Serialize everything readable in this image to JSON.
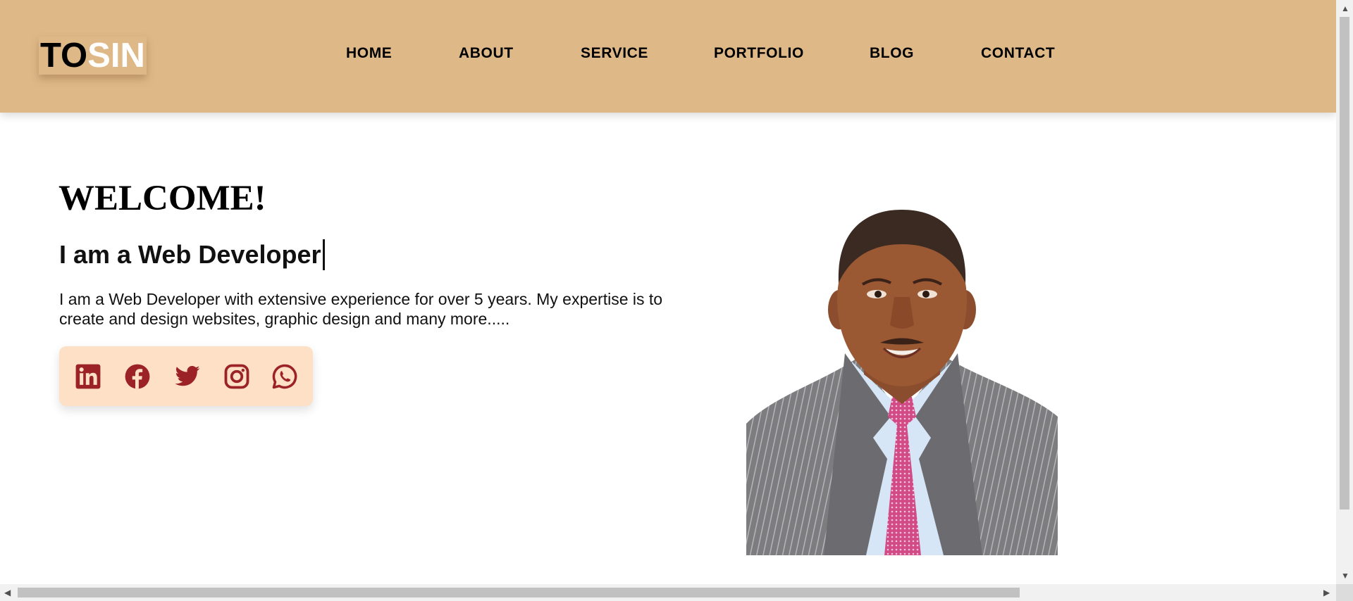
{
  "brand": {
    "part1": "TO",
    "part2": "SIN"
  },
  "nav": {
    "items": [
      {
        "label": "HOME"
      },
      {
        "label": "ABOUT"
      },
      {
        "label": "SERVICE"
      },
      {
        "label": "PORTFOLIO"
      },
      {
        "label": "BLOG"
      },
      {
        "label": "CONTACT"
      }
    ]
  },
  "hero": {
    "title": "WELCOME!",
    "subtitle": "I am a Web Developer",
    "paragraph": "I am a Web Developer with extensive experience for over 5 years. My expertise is to create and design websites, graphic design and many more....."
  },
  "social": {
    "icons": [
      "linkedin-icon",
      "facebook-icon",
      "twitter-icon",
      "instagram-icon",
      "whatsapp-icon"
    ],
    "icon_color": "#9b2226"
  },
  "colors": {
    "header_bg": "#dfb888",
    "social_bg": "#fde0c6",
    "page_bg": "#ffffff"
  }
}
